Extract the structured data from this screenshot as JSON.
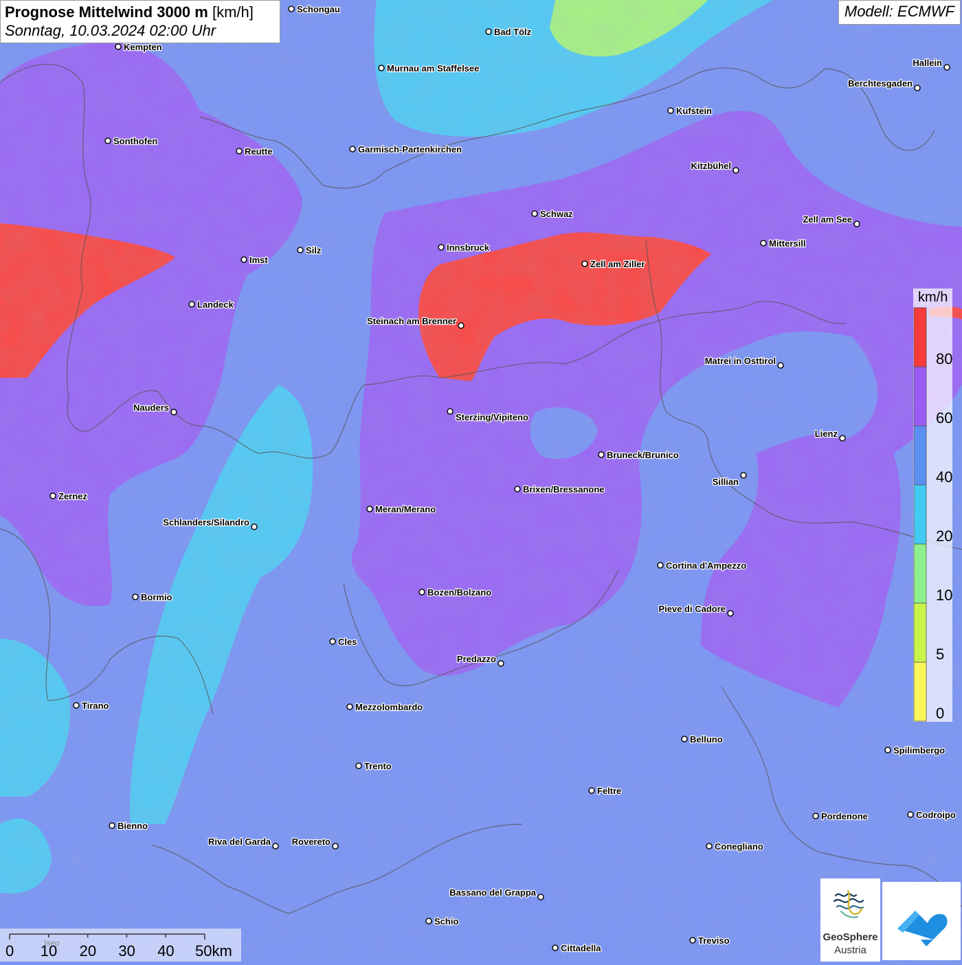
{
  "title": {
    "main_bold": "Prognose Mittelwind 3000 m",
    "unit": "[km/h]",
    "datetime": "Sonntag, 10.03.2024 02:00 Uhr"
  },
  "model": "Modell: ECMWF",
  "legend": {
    "unit": "km/h",
    "classes": [
      {
        "label": "0",
        "color": "#fbf55a"
      },
      {
        "label": "5",
        "color": "#c9f54a"
      },
      {
        "label": "10",
        "color": "#8ef08c"
      },
      {
        "label": "20",
        "color": "#42cbf3"
      },
      {
        "label": "40",
        "color": "#5b8ff1"
      },
      {
        "label": "60",
        "color": "#9a5cf4"
      },
      {
        "label": "80",
        "color": "#f73a3a"
      }
    ]
  },
  "cities": [
    "Schongau",
    "Bad Tölz",
    "Kempten",
    "Murnau am Staffelsee",
    "Hallein",
    "Berchtesgaden",
    "Kufstein",
    "Sonthofen",
    "Reutte",
    "Garmisch-Partenkirchen",
    "Kitzbühel",
    "Schwaz",
    "Zell am See",
    "Mittersill",
    "Innsbruck",
    "Silz",
    "Imst",
    "Zell am Ziller",
    "Landeck",
    "Steinach am Brenner",
    "Matrei in Osttirol",
    "Nauders",
    "Sterzing/Vipiteno",
    "Lienz",
    "Bruneck/Brunico",
    "Sillian",
    "Brixen/Bressanone",
    "Zernez",
    "Meran/Merano",
    "Schlanders/Silandro",
    "Cortina d'Ampezzo",
    "Bozen/Bolzano",
    "Bormio",
    "Pieve di Cadore",
    "Cles",
    "Predazzo",
    "Tirano",
    "Mezzolombardo",
    "Belluno",
    "Spilimbergo",
    "Trento",
    "Feltre",
    "Pordenone",
    "Codroipo",
    "Bienno",
    "Riva del Garda",
    "Rovereto",
    "Conegliano",
    "Bassano del Grappa",
    "Schio",
    "Treviso",
    "Cittadella"
  ],
  "scale": {
    "ticks": [
      "0",
      "10",
      "20",
      "30",
      "40",
      "50km"
    ],
    "city_under_bar": "Iseo"
  },
  "logos": {
    "geosphere_line1": "GeoSphere",
    "geosphere_line2": "Austria"
  },
  "icons": {
    "geosphere_logo": "geosphere-logo-icon",
    "weather_logo": "weather-app-logo-icon"
  }
}
